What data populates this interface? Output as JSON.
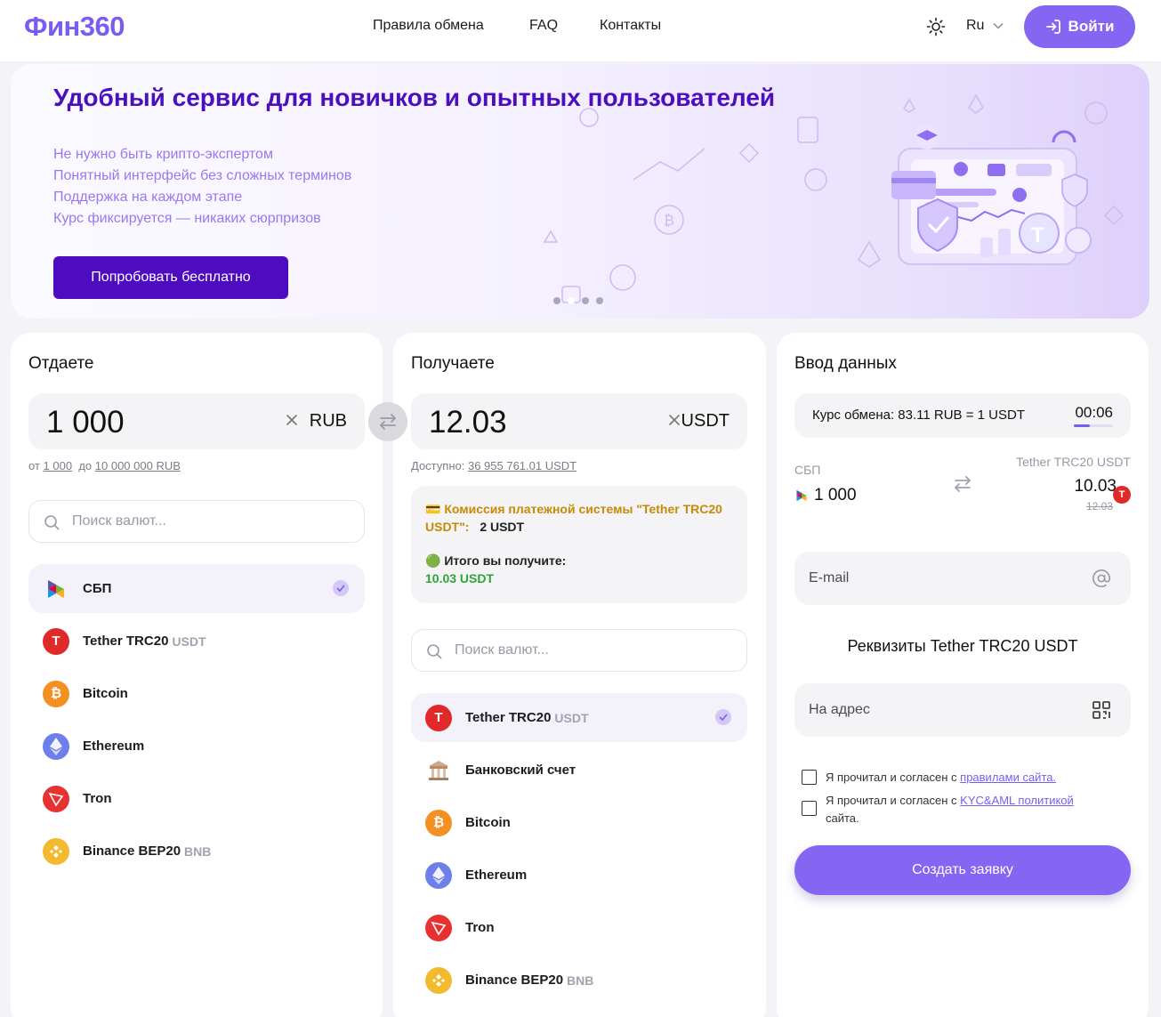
{
  "header": {
    "logo": "Фин360",
    "nav": {
      "rules": "Правила обмена",
      "faq": "FAQ",
      "contacts": "Контакты"
    },
    "lang": "Ru",
    "login": "Войти"
  },
  "banner": {
    "title": "Удобный сервис для новичков и опытных пользователей",
    "points": [
      "Не нужно быть крипто-экспертом",
      "Понятный интерфейс без сложных терминов",
      "Поддержка на каждом этапе",
      "Курс фиксируется — никаких сюрпризов"
    ],
    "cta": "Попробовать бесплатно",
    "slides": 4,
    "active_slide": 2
  },
  "give": {
    "title": "Отдаете",
    "amount": "1 000",
    "currency": "RUB",
    "range_from_label": "от",
    "range_from": "1 000",
    "range_to_label": "до",
    "range_to": "10 000 000 RUB",
    "search_placeholder": "Поиск валют...",
    "items": [
      {
        "name": "СБП",
        "ticker": ""
      },
      {
        "name": "Tether TRC20",
        "ticker": "USDT"
      },
      {
        "name": "Bitcoin",
        "ticker": ""
      },
      {
        "name": "Ethereum",
        "ticker": ""
      },
      {
        "name": "Tron",
        "ticker": ""
      },
      {
        "name": "Binance BEP20",
        "ticker": "BNB"
      }
    ]
  },
  "get": {
    "title": "Получаете",
    "amount": "12.03",
    "currency": "USDT",
    "available_label": "Доступно:",
    "available": "36 955 761.01 USDT",
    "commission_label": "💳 Комиссия платежной системы \"Tether TRC20 USDT\":",
    "commission_value": "2 USDT",
    "total_label": "🟢 Итого вы получите:",
    "total_value": "10.03 USDT",
    "search_placeholder": "Поиск валют...",
    "items": [
      {
        "name": "Tether TRC20",
        "ticker": "USDT"
      },
      {
        "name": "Банковский счет",
        "ticker": ""
      },
      {
        "name": "Bitcoin",
        "ticker": ""
      },
      {
        "name": "Ethereum",
        "ticker": ""
      },
      {
        "name": "Tron",
        "ticker": ""
      },
      {
        "name": "Binance BEP20",
        "ticker": "BNB"
      }
    ]
  },
  "data": {
    "title": "Ввод данных",
    "rate": "Курс обмена: 83.11 RUB = 1 USDT",
    "timer": "00:06",
    "timer_progress": 0.4,
    "from_label": "СБП",
    "from_amount": "1 000",
    "to_label": "Tether TRC20 USDT",
    "to_amount": "10.03",
    "to_old": "12.03",
    "email_placeholder": "E-mail",
    "requisites_title": "Реквизиты Tether TRC20 USDT",
    "address_placeholder": "На адрес",
    "agree1_text": "Я прочитал и согласен с",
    "agree1_link": "правилами сайта.",
    "agree2_text": "Я прочитал и согласен с",
    "agree2_link": "KYC&AML политикой",
    "agree2_tail": "сайта.",
    "submit": "Создать заявку"
  },
  "colors": {
    "accent": "#8466f2",
    "banner_title": "#4b0fbf",
    "banner_button": "#4d0cbf",
    "commission": "#c88a04",
    "total": "#2da539"
  }
}
